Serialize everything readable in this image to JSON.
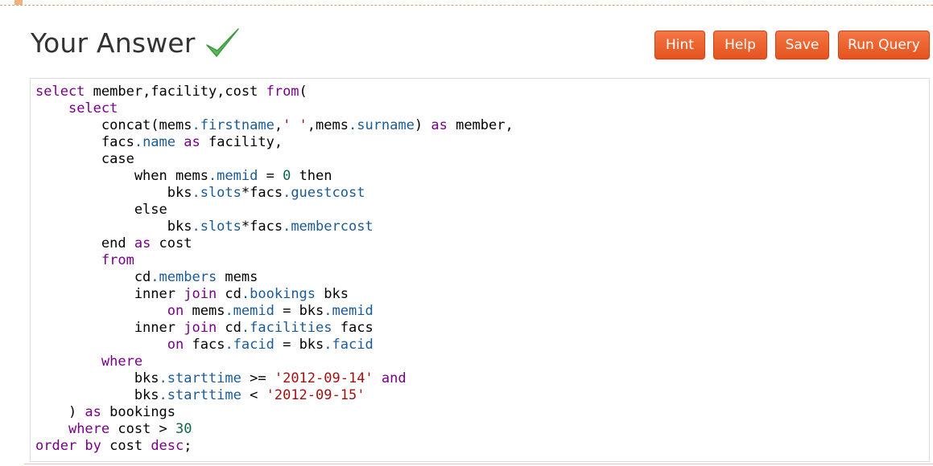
{
  "header": {
    "title": "Your Answer",
    "check_icon": "checkmark-icon",
    "check_color": "#4caf50"
  },
  "toolbar": {
    "hint_label": "Hint",
    "help_label": "Help",
    "save_label": "Save",
    "run_label": "Run Query",
    "button_color": "#ef5f2d"
  },
  "editor": {
    "colors": {
      "keyword": "#770088",
      "property": "#1a5a96",
      "string": "#a11111",
      "number": "#116644",
      "plain": "#000000"
    },
    "lines": [
      [
        [
          "k",
          "select"
        ],
        [
          "p",
          " member,facility,cost "
        ],
        [
          "k",
          "from"
        ],
        [
          "p",
          "("
        ]
      ],
      [
        [
          "p",
          "    "
        ],
        [
          "k",
          "select"
        ]
      ],
      [
        [
          "p",
          "        concat(mems"
        ],
        [
          "r",
          ".firstname"
        ],
        [
          "p",
          ","
        ],
        [
          "s",
          "' '"
        ],
        [
          "p",
          ",mems"
        ],
        [
          "r",
          ".surname"
        ],
        [
          "p",
          ") "
        ],
        [
          "k",
          "as"
        ],
        [
          "p",
          " member,"
        ]
      ],
      [
        [
          "p",
          "        facs"
        ],
        [
          "r",
          ".name"
        ],
        [
          "p",
          " "
        ],
        [
          "k",
          "as"
        ],
        [
          "p",
          " facility,"
        ]
      ],
      [
        [
          "p",
          "        case"
        ]
      ],
      [
        [
          "p",
          "            when mems"
        ],
        [
          "r",
          ".memid"
        ],
        [
          "p",
          " = "
        ],
        [
          "n",
          "0"
        ],
        [
          "p",
          " then"
        ]
      ],
      [
        [
          "p",
          "                bks"
        ],
        [
          "r",
          ".slots"
        ],
        [
          "p",
          "*facs"
        ],
        [
          "r",
          ".guestcost"
        ]
      ],
      [
        [
          "p",
          "            else"
        ]
      ],
      [
        [
          "p",
          "                bks"
        ],
        [
          "r",
          ".slots"
        ],
        [
          "p",
          "*facs"
        ],
        [
          "r",
          ".membercost"
        ]
      ],
      [
        [
          "p",
          "        end "
        ],
        [
          "k",
          "as"
        ],
        [
          "p",
          " cost"
        ]
      ],
      [
        [
          "p",
          "        "
        ],
        [
          "k",
          "from"
        ]
      ],
      [
        [
          "p",
          "            cd"
        ],
        [
          "r",
          ".members"
        ],
        [
          "p",
          " mems"
        ]
      ],
      [
        [
          "p",
          "            inner "
        ],
        [
          "k",
          "join"
        ],
        [
          "p",
          " cd"
        ],
        [
          "r",
          ".bookings"
        ],
        [
          "p",
          " bks"
        ]
      ],
      [
        [
          "p",
          "                "
        ],
        [
          "k",
          "on"
        ],
        [
          "p",
          " mems"
        ],
        [
          "r",
          ".memid"
        ],
        [
          "p",
          " = bks"
        ],
        [
          "r",
          ".memid"
        ]
      ],
      [
        [
          "p",
          "            inner "
        ],
        [
          "k",
          "join"
        ],
        [
          "p",
          " cd"
        ],
        [
          "r",
          ".facilities"
        ],
        [
          "p",
          " facs"
        ]
      ],
      [
        [
          "p",
          "                "
        ],
        [
          "k",
          "on"
        ],
        [
          "p",
          " facs"
        ],
        [
          "r",
          ".facid"
        ],
        [
          "p",
          " = bks"
        ],
        [
          "r",
          ".facid"
        ]
      ],
      [
        [
          "p",
          "        "
        ],
        [
          "k",
          "where"
        ]
      ],
      [
        [
          "p",
          "            bks"
        ],
        [
          "r",
          ".starttime"
        ],
        [
          "p",
          " >= "
        ],
        [
          "s",
          "'2012-09-14'"
        ],
        [
          "p",
          " "
        ],
        [
          "k",
          "and"
        ]
      ],
      [
        [
          "p",
          "            bks"
        ],
        [
          "r",
          ".starttime"
        ],
        [
          "p",
          " < "
        ],
        [
          "s",
          "'2012-09-15'"
        ]
      ],
      [
        [
          "p",
          "    ) "
        ],
        [
          "k",
          "as"
        ],
        [
          "p",
          " bookings"
        ]
      ],
      [
        [
          "p",
          "    "
        ],
        [
          "k",
          "where"
        ],
        [
          "p",
          " cost > "
        ],
        [
          "n",
          "30"
        ]
      ],
      [
        [
          "k",
          "order by"
        ],
        [
          "p",
          " cost "
        ],
        [
          "k",
          "desc"
        ],
        [
          "p",
          ";"
        ]
      ]
    ]
  }
}
